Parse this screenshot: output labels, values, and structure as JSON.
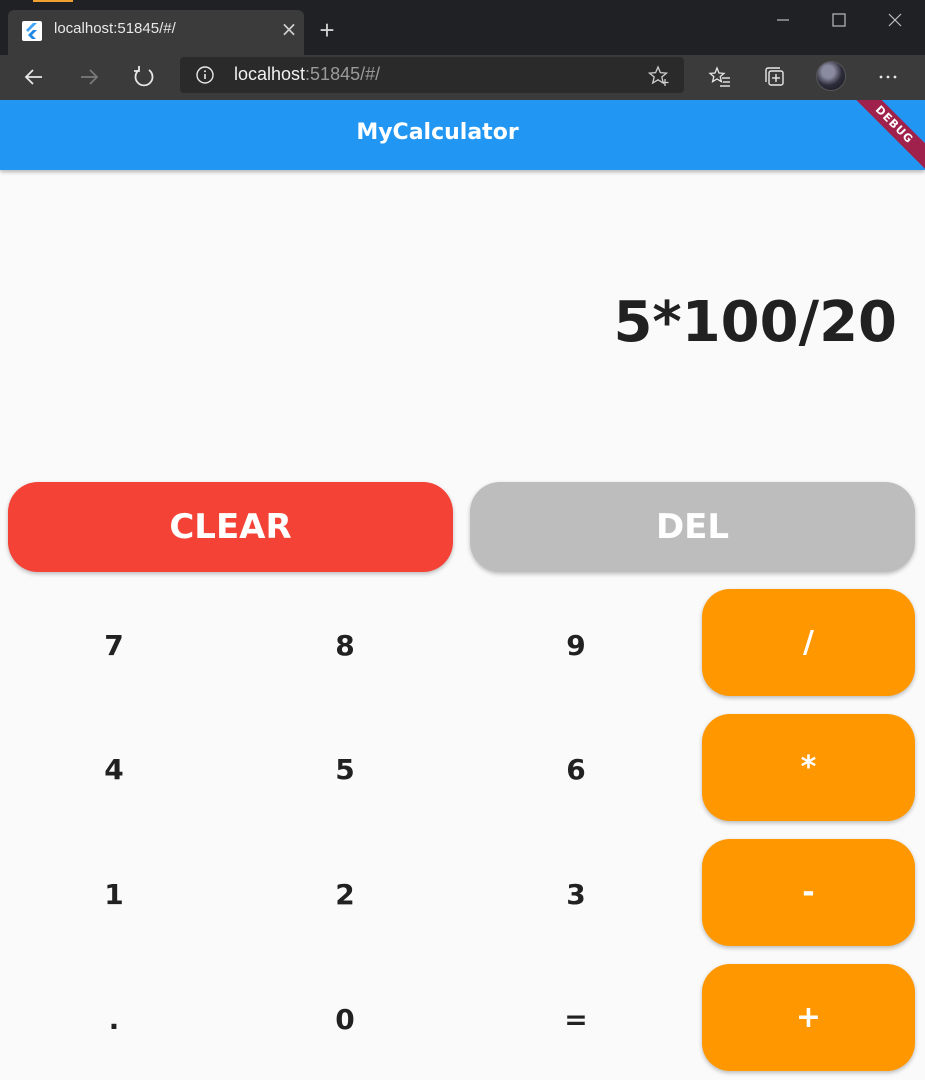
{
  "browser": {
    "tab_title": "localhost:51845/#/",
    "url_host": "localhost",
    "url_rest": ":51845/#/"
  },
  "app": {
    "title": "MyCalculator",
    "debug_banner": "DEBUG",
    "display": "5*100/20",
    "clear_label": "CLEAR",
    "del_label": "DEL",
    "keys": {
      "k7": "7",
      "k8": "8",
      "k9": "9",
      "k4": "4",
      "k5": "5",
      "k6": "6",
      "k1": "1",
      "k2": "2",
      "k3": "3",
      "kdot": ".",
      "k0": "0",
      "keq": "="
    },
    "ops": {
      "divide": "/",
      "multiply": "*",
      "minus": "-",
      "plus": "+"
    },
    "colors": {
      "appbar": "#2196f3",
      "clear": "#f44336",
      "del": "#bdbdbd",
      "operator": "#ff9800",
      "debug": "#a0224c"
    }
  }
}
